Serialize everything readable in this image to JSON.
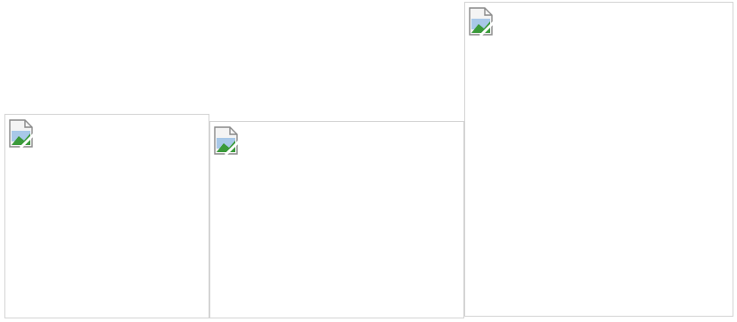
{
  "images": [
    {
      "id": "image-1",
      "state": "broken",
      "icon": "broken-image-icon"
    },
    {
      "id": "image-2",
      "state": "broken",
      "icon": "broken-image-icon"
    },
    {
      "id": "image-3",
      "state": "broken",
      "icon": "broken-image-icon"
    }
  ],
  "colors": {
    "frame_border": "#d4d4d4",
    "icon_paper": "#f4f4f4",
    "icon_sky": "#a8c8e8",
    "icon_hill": "#3a9a3a"
  }
}
